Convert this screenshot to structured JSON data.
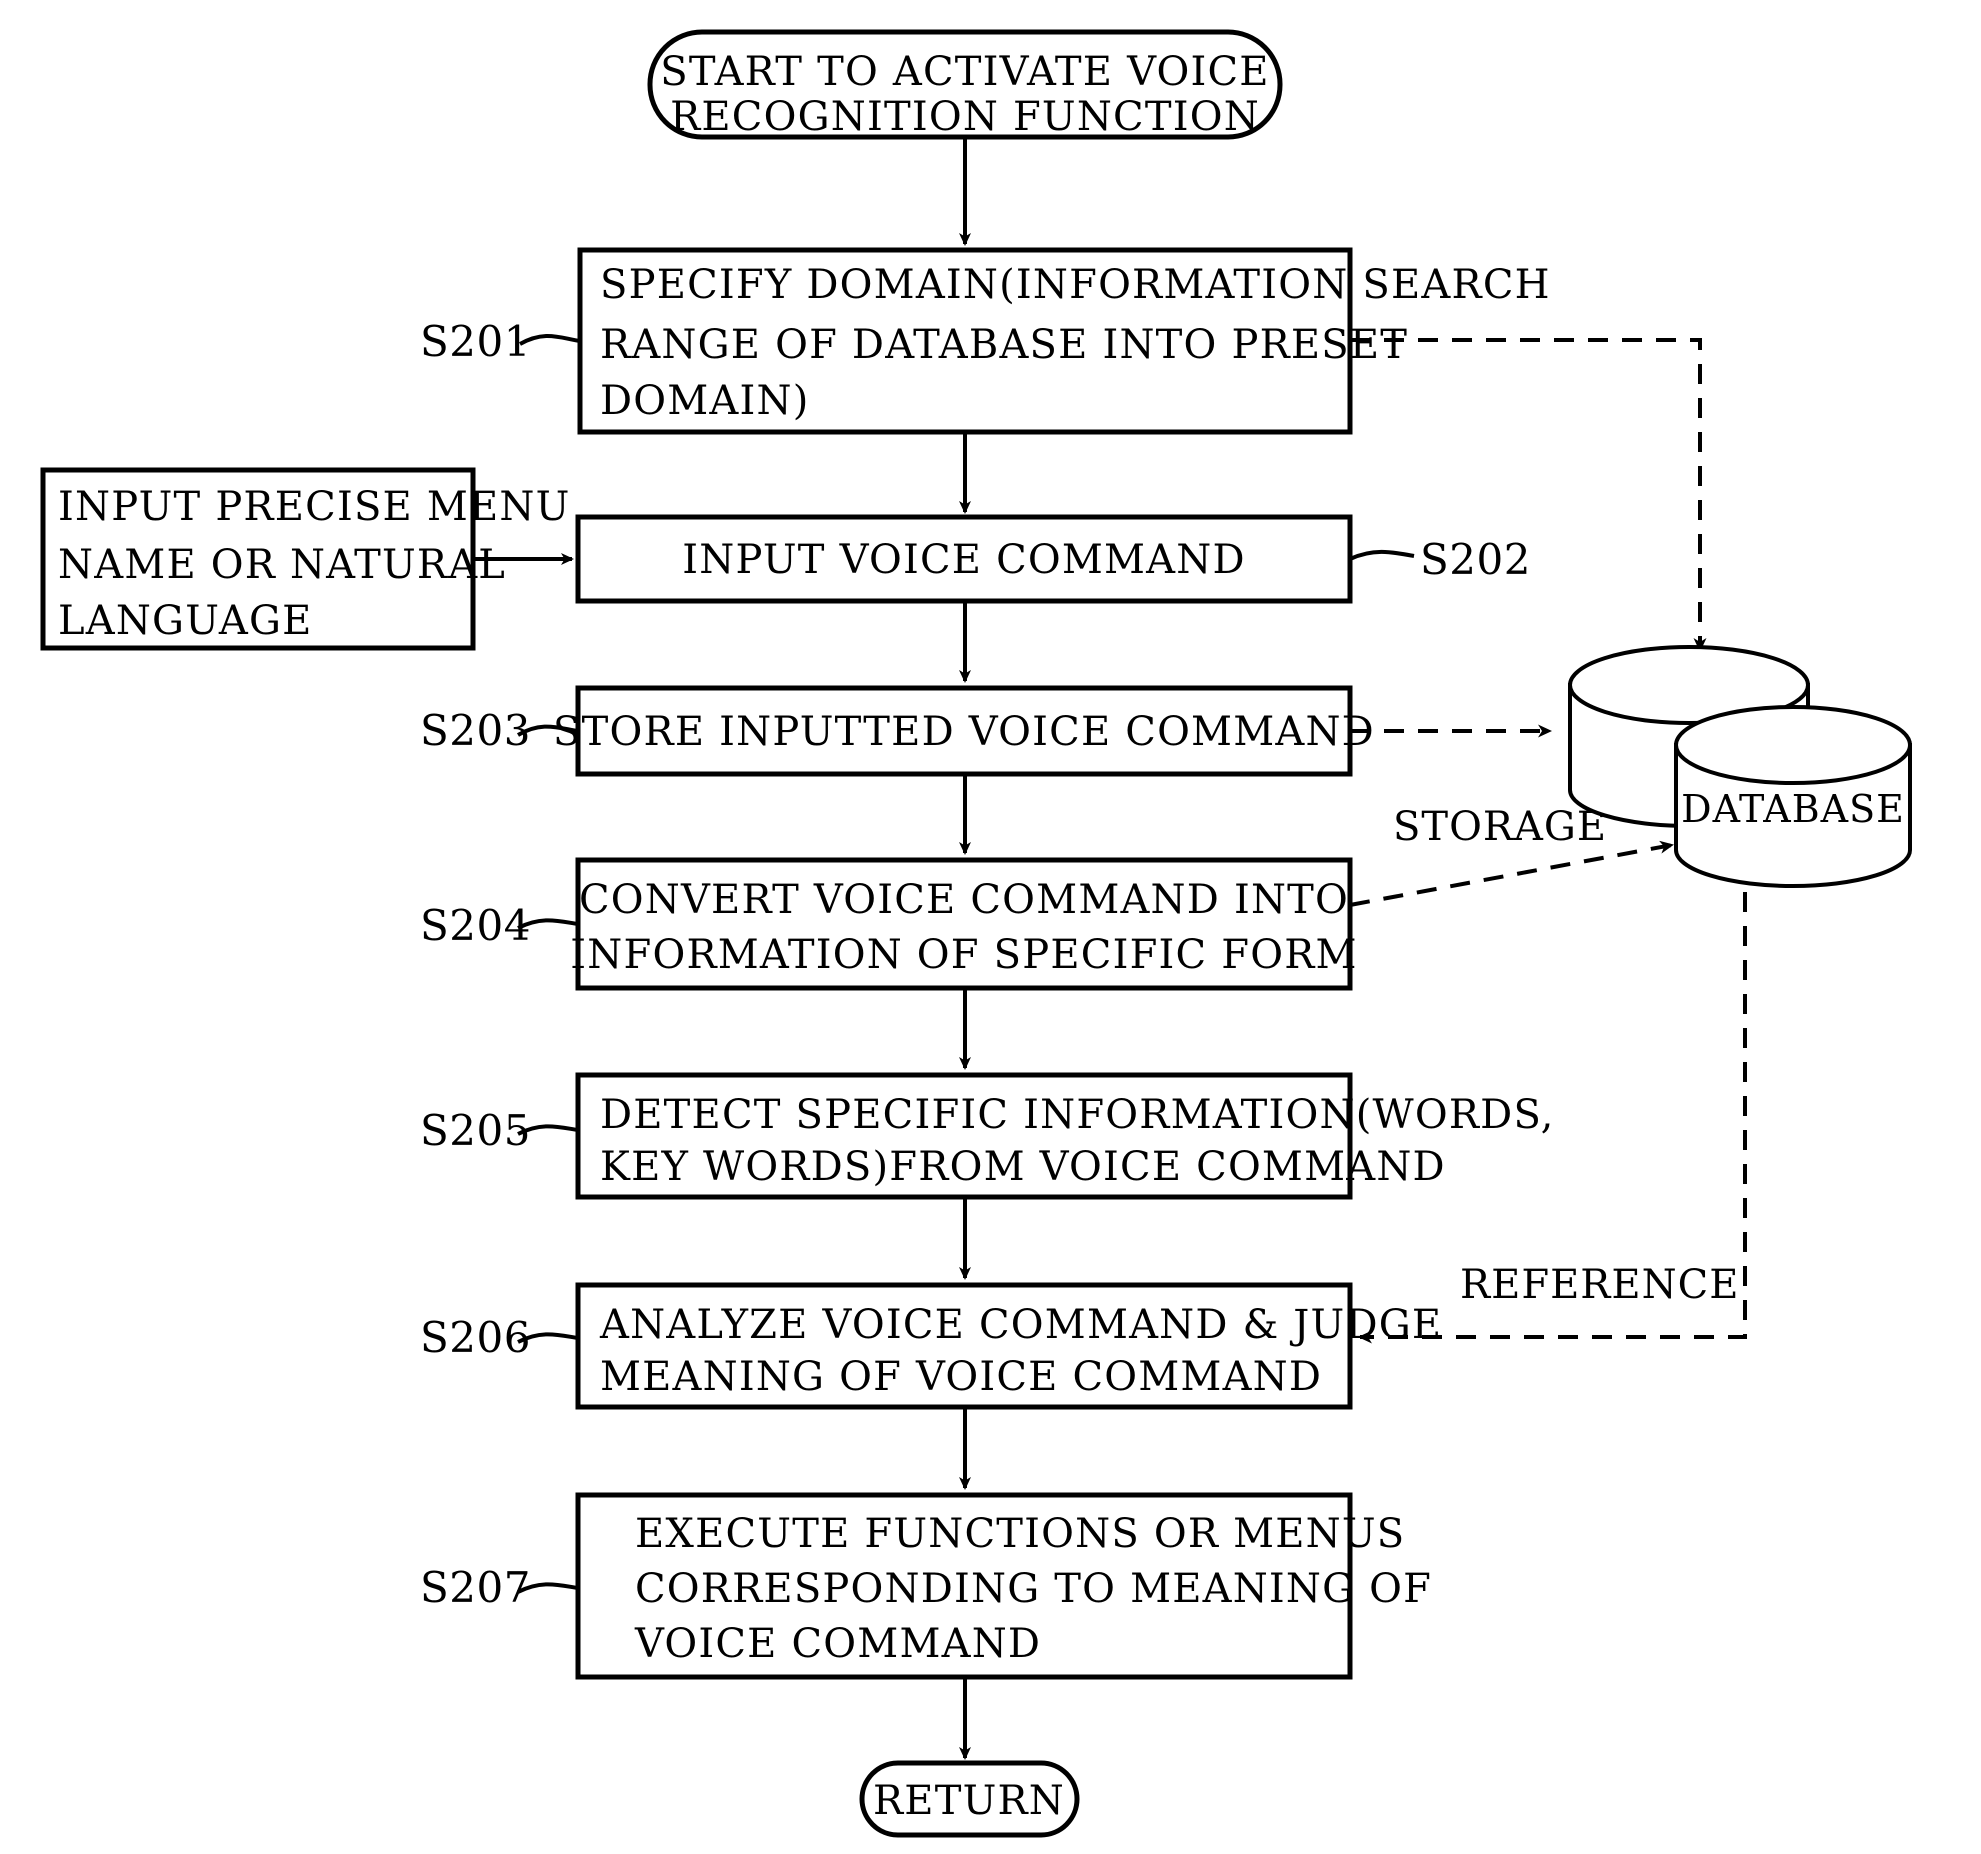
{
  "diagram": {
    "title": "Voice recognition function flowchart",
    "terminals": {
      "start": "START TO ACTIVATE VOICE\nRECOGNITION FUNCTION",
      "start_line1": "START TO ACTIVATE VOICE",
      "start_line2": "RECOGNITION FUNCTION",
      "end": "RETURN"
    },
    "side_note": {
      "line1": "INPUT PRECISE MENU",
      "line2": "NAME OR NATURAL",
      "line3": "LANGUAGE"
    },
    "steps": [
      {
        "id": "S201",
        "label": "S201",
        "lines": [
          "SPECIFY DOMAIN(INFORMATION SEARCH",
          "RANGE OF DATABASE INTO PRESET",
          "DOMAIN)"
        ]
      },
      {
        "id": "S202",
        "label": "S202",
        "lines": [
          "INPUT VOICE COMMAND"
        ]
      },
      {
        "id": "S203",
        "label": "S203",
        "lines": [
          "STORE INPUTTED VOICE COMMAND"
        ]
      },
      {
        "id": "S204",
        "label": "S204",
        "lines": [
          "CONVERT VOICE COMMAND INTO",
          "INFORMATION OF SPECIFIC FORM"
        ]
      },
      {
        "id": "S205",
        "label": "S205",
        "lines": [
          "DETECT SPECIFIC INFORMATION(WORDS,",
          "KEY WORDS)FROM VOICE COMMAND"
        ]
      },
      {
        "id": "S206",
        "label": "S206",
        "lines": [
          "ANALYZE VOICE COMMAND & JUDGE",
          "MEANING OF VOICE COMMAND"
        ]
      },
      {
        "id": "S207",
        "label": "S207",
        "lines": [
          "EXECUTE FUNCTIONS OR MENUS",
          "CORRESPONDING TO MEANING OF",
          "VOICE COMMAND"
        ]
      }
    ],
    "datastore": {
      "label": "DATABASE"
    },
    "annotations": {
      "storage": "STORAGE",
      "reference": "REFERENCE"
    },
    "colors": {
      "ink": "#000000",
      "paper": "#ffffff"
    }
  }
}
